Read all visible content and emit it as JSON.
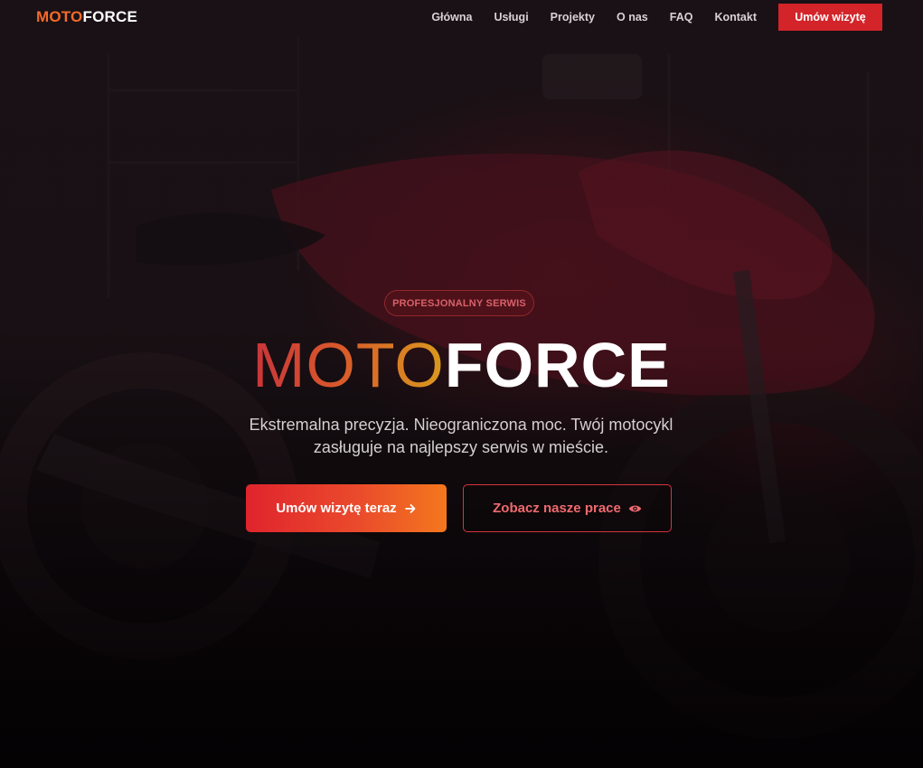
{
  "nav": {
    "logo_part1": "MOTO",
    "logo_part2": "FORCE",
    "links": [
      "Główna",
      "Usługi",
      "Projekty",
      "O nas",
      "FAQ",
      "Kontakt"
    ],
    "cta_label": "Umów wizytę"
  },
  "hero": {
    "badge": "PROFESJONALNY SERWIS",
    "title_part1": "MOTO",
    "title_part2": "FORCE",
    "subtitle_line1": "Ekstremalna precyzja. Nieograniczona moc. Twój motocykl",
    "subtitle_line2": "zasługuje na najlepszy serwis w mieście.",
    "primary_button": "Umów wizytę teraz",
    "secondary_button": "Zobacz nasze prace"
  },
  "icons": {
    "primary_button_icon": "arrow-right-icon",
    "secondary_button_icon": "eye-icon"
  },
  "colors": {
    "accent_red": "#d3242a",
    "accent_orange": "#f4771e",
    "logo_orange": "#f26a2b",
    "background": "#0b0709"
  }
}
